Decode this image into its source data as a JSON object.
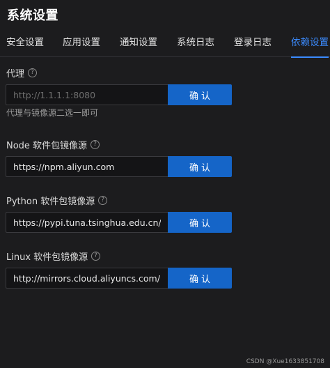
{
  "app": {
    "title": "系统设置"
  },
  "tabs": [
    {
      "label": "安全设置"
    },
    {
      "label": "应用设置"
    },
    {
      "label": "通知设置"
    },
    {
      "label": "系统日志"
    },
    {
      "label": "登录日志"
    },
    {
      "label": "依赖设置",
      "active": true
    }
  ],
  "proxy": {
    "label": "代理",
    "placeholder": "http://1.1.1.1:8080",
    "value": "",
    "button": "确认",
    "hint": "代理与镜像源二选一即可"
  },
  "node": {
    "label": "Node 软件包镜像源",
    "value": "https://npm.aliyun.com",
    "button": "确认"
  },
  "python": {
    "label": "Python 软件包镜像源",
    "value": "https://pypi.tuna.tsinghua.edu.cn/sim",
    "button": "确认"
  },
  "linux": {
    "label": "Linux 软件包镜像源",
    "value": "http://mirrors.cloud.aliyuncs.com/",
    "button": "确认"
  },
  "help_icon": {
    "glyph": "?"
  },
  "watermark": "CSDN @Xue1633851708",
  "colors": {
    "accent": "#3b8bff",
    "button": "#1565c8",
    "background": "#1c1c1e"
  }
}
